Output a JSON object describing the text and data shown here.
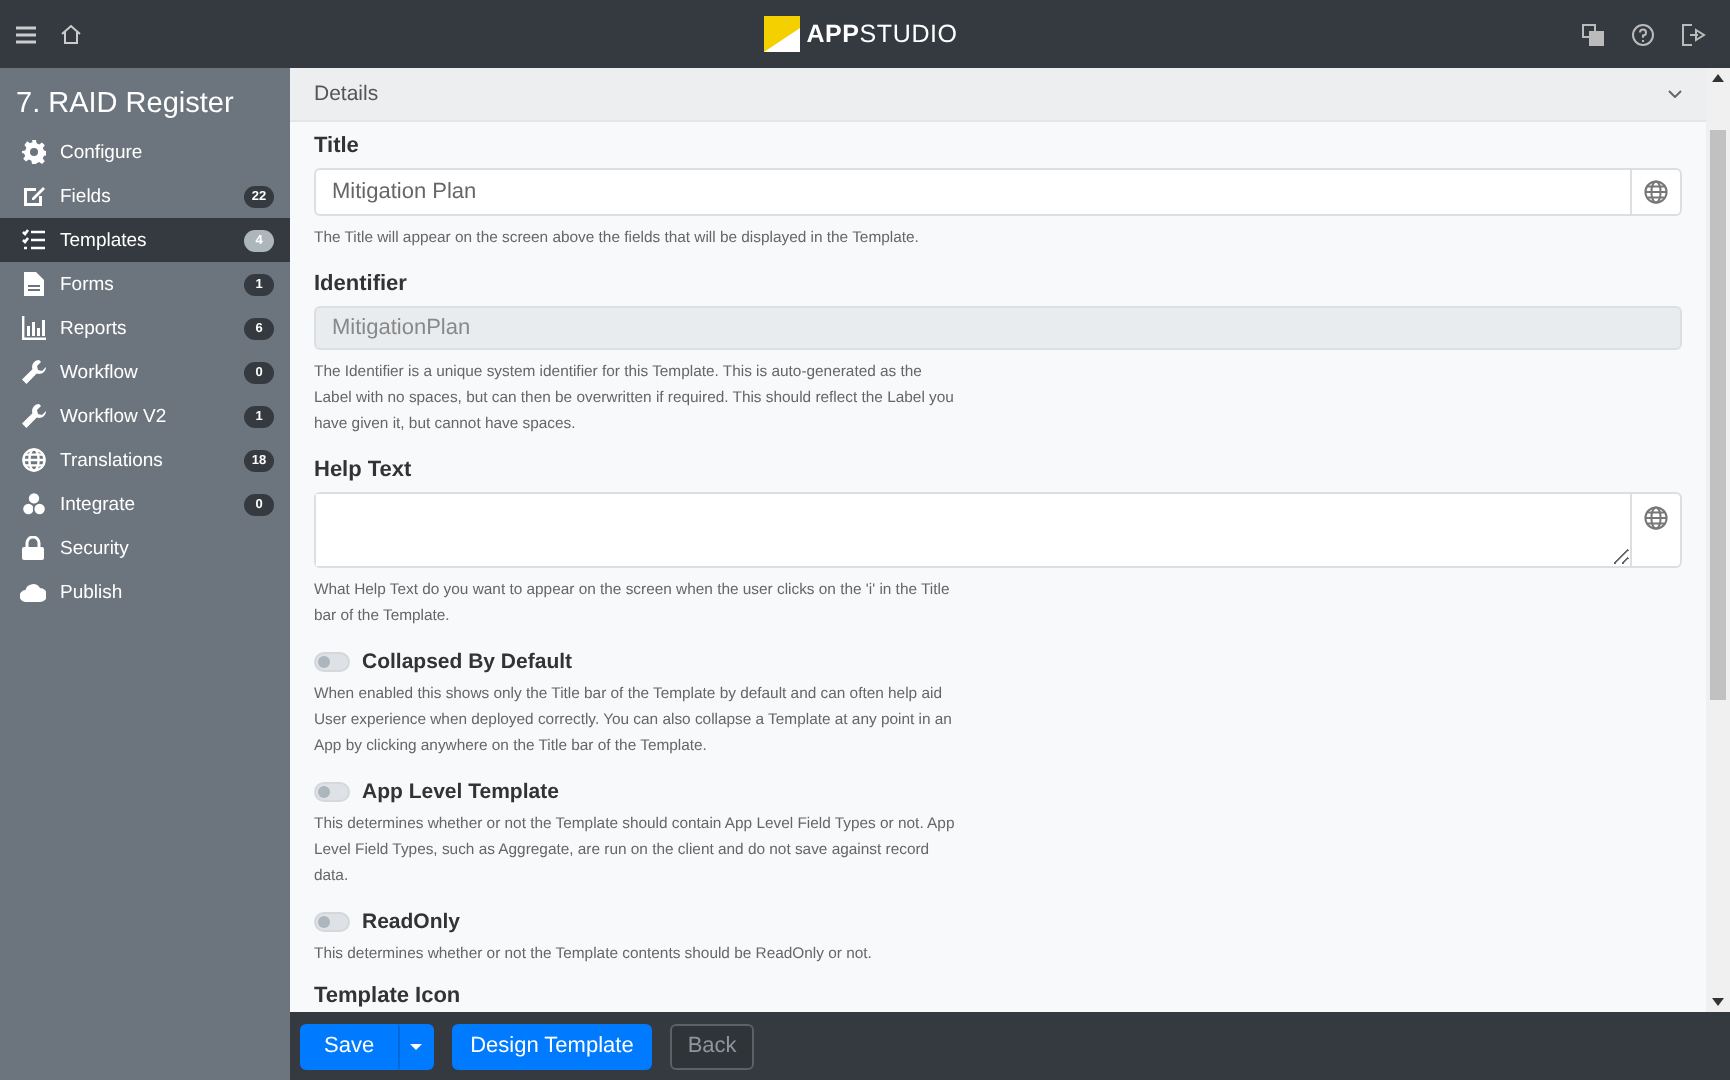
{
  "topbar": {
    "logo": "**APP**STUDIO"
  },
  "sidebar": {
    "title": "7. RAID Register",
    "items": [
      {
        "kind": "gear",
        "label": "Configure",
        "selected": false
      },
      {
        "kind": "edit",
        "label": "Fields",
        "badge": "22",
        "selected": false
      },
      {
        "kind": "list",
        "label": "Templates",
        "badge": "4",
        "selected": true
      },
      {
        "kind": "document",
        "label": "Forms",
        "badge": "1",
        "selected": false
      },
      {
        "kind": "chart",
        "label": "Reports",
        "badge": "6",
        "selected": false
      },
      {
        "kind": "wrench",
        "label": "Workflow",
        "badge": "0",
        "selected": false
      },
      {
        "kind": "wrench",
        "label": "Workflow V2",
        "badge": "1",
        "selected": false
      },
      {
        "kind": "globe",
        "label": "Translations",
        "badge": "18",
        "selected": false
      },
      {
        "kind": "network",
        "label": "Integrate",
        "badge": "0",
        "selected": false
      },
      {
        "kind": "lock",
        "label": "Security",
        "selected": false
      },
      {
        "kind": "cloud",
        "label": "Publish",
        "selected": false
      }
    ]
  },
  "details": {
    "title": "Details",
    "fields": [
      {
        "kind": "text",
        "label": "Title",
        "value": "Mitigation Plan",
        "help": "The Title will appear on the screen above the fields that will be displayed in the Template."
      },
      {
        "kind": "readonly",
        "label": "Identifier",
        "value": "MitigationPlan",
        "help": "The Identifier is a unique system identifier for this Template. This is auto-generated as the Label with no spaces, but can then be overwritten if required. This should reflect the Label you have given it, but cannot have spaces."
      },
      {
        "kind": "textarea",
        "label": "Help Text",
        "help": "What Help Text do you want to appear on the screen when the user clicks on the 'i' in the Title bar of the Template."
      },
      {
        "kind": "toggle",
        "label": "Collapsed By Default",
        "on": false,
        "help": "When enabled this shows only the Title bar of the Template by default and can often help aid User experience when deployed correctly. You can also collapse a Template at any point in an App by clicking anywhere on the Title bar of the Template."
      },
      {
        "kind": "toggle",
        "label": "App Level Template",
        "on": false,
        "help": "This determines whether or not the Template should contain App Level Field Types or not. App Level Field Types, such as Aggregate, are run on the client and do not save against record data."
      },
      {
        "kind": "toggle",
        "label": "ReadOnly",
        "on": false,
        "help": "This determines whether or not the Template contents should be ReadOnly or not."
      },
      {
        "kind": "heading",
        "label": "Template Icon"
      }
    ]
  },
  "footer": {
    "buttons": [
      {
        "kind": "split",
        "label": "Save",
        "disabled": false
      },
      {
        "kind": "primary",
        "label": "Design Template",
        "disabled": false
      },
      {
        "kind": "outline",
        "label": "Back",
        "disabled": true
      }
    ]
  }
}
